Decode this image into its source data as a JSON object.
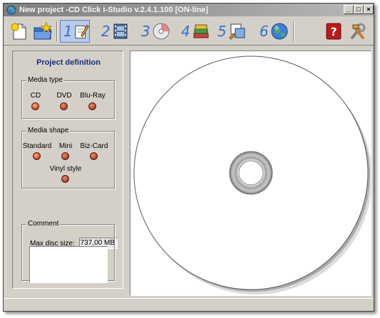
{
  "window": {
    "title": "New project -CD Click i-Studio v.2.4.1.100 [ON-line]",
    "minimize_glyph": "_",
    "maximize_glyph": "□",
    "close_glyph": "×"
  },
  "toolbar": {
    "buttons": [
      {
        "name": "new-project",
        "icon": "new-document-icon"
      },
      {
        "name": "open-project",
        "icon": "open-folder-star-icon"
      },
      {
        "step": "1",
        "icon": "edit-pencil-icon",
        "selected": true
      },
      {
        "step": "2",
        "icon": "film-strip-icon"
      },
      {
        "step": "3",
        "icon": "disc-icon"
      },
      {
        "step": "4",
        "icon": "book-stack-icon"
      },
      {
        "step": "5",
        "icon": "print-layout-icon"
      },
      {
        "step": "6",
        "icon": "globe-icon"
      },
      {
        "name": "help",
        "icon": "help-icon"
      },
      {
        "name": "settings",
        "icon": "tools-icon"
      }
    ]
  },
  "panel": {
    "title": "Project definition",
    "media_type": {
      "label": "Media type",
      "options": [
        "CD",
        "DVD",
        "Blu-Ray"
      ],
      "selected": "CD"
    },
    "media_shape": {
      "label": "Media shape",
      "options": [
        "Standard",
        "Mini",
        "Biz-Card",
        "Vinyl style"
      ],
      "selected": "Standard"
    },
    "max_disc_size": {
      "label": "Max disc size:",
      "value": "737,00 MB"
    },
    "comment": {
      "label": "Comment",
      "value": ""
    }
  },
  "colors": {
    "window_bg": "#d4d0c8",
    "panel_title": "#1a2a80",
    "step_number": "#3a6fd0",
    "led": "#c0502a"
  }
}
